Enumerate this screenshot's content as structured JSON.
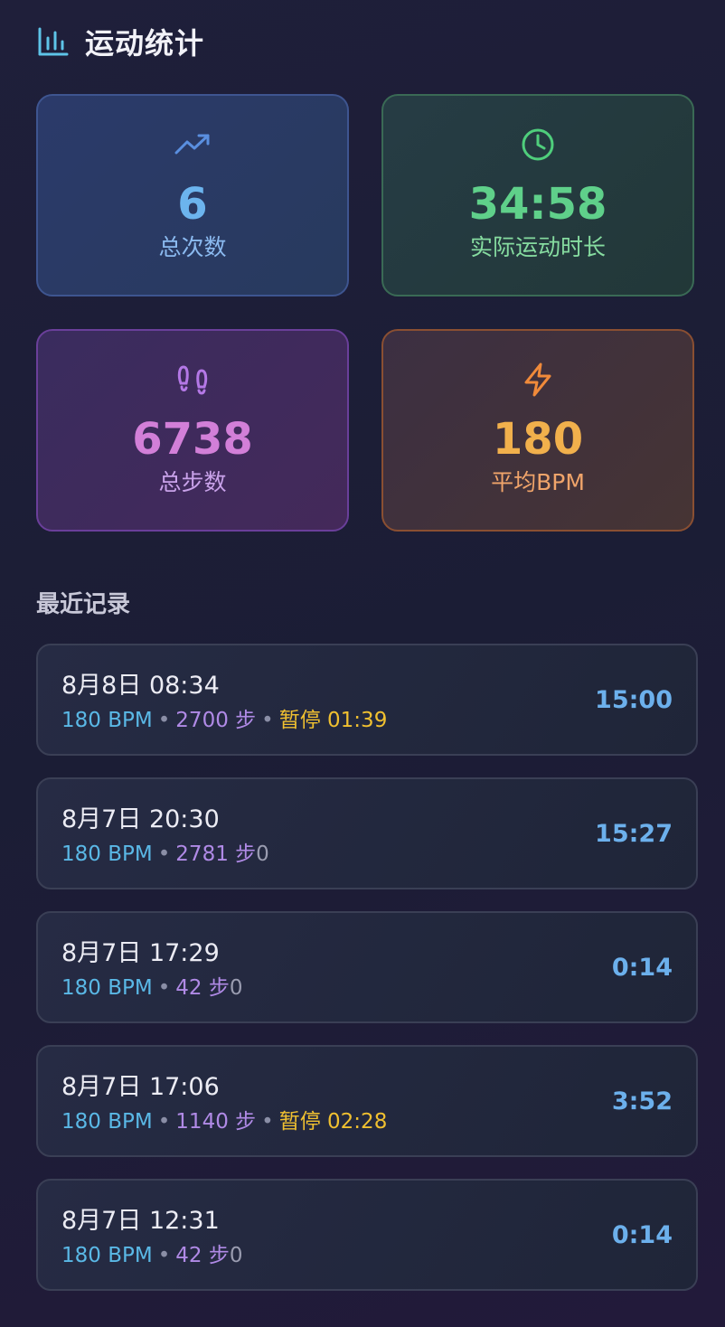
{
  "header": {
    "icon": "bar-chart-icon",
    "title": "运动统计"
  },
  "stats": [
    {
      "icon": "trending-up-icon",
      "value": "6",
      "label": "总次数",
      "color": "#6cb4ee"
    },
    {
      "icon": "clock-icon",
      "value": "34:58",
      "label": "实际运动时长",
      "color": "#5fd08a"
    },
    {
      "icon": "footprints-icon",
      "value": "6738",
      "label": "总步数",
      "color": "#d27fd8"
    },
    {
      "icon": "lightning-icon",
      "value": "180",
      "label": "平均BPM",
      "color": "#f1b04c"
    }
  ],
  "recent": {
    "title": "最近记录",
    "records": [
      {
        "date": "8月8日 08:34",
        "bpm": "180 BPM",
        "sep1": "•",
        "steps": "2700 步",
        "sep2": "•",
        "pause": "暂停 01:39",
        "zero": "",
        "duration": "15:00"
      },
      {
        "date": "8月7日 20:30",
        "bpm": "180 BPM",
        "sep1": "•",
        "steps": "2781 步",
        "sep2": "",
        "pause": "",
        "zero": "0",
        "duration": "15:27"
      },
      {
        "date": "8月7日 17:29",
        "bpm": "180 BPM",
        "sep1": "•",
        "steps": "42 步",
        "sep2": "",
        "pause": "",
        "zero": "0",
        "duration": "0:14"
      },
      {
        "date": "8月7日 17:06",
        "bpm": "180 BPM",
        "sep1": "•",
        "steps": "1140 步",
        "sep2": "•",
        "pause": "暂停 02:28",
        "zero": "",
        "duration": "3:52"
      },
      {
        "date": "8月7日 12:31",
        "bpm": "180 BPM",
        "sep1": "•",
        "steps": "42 步",
        "sep2": "",
        "pause": "",
        "zero": "0",
        "duration": "0:14"
      }
    ]
  }
}
